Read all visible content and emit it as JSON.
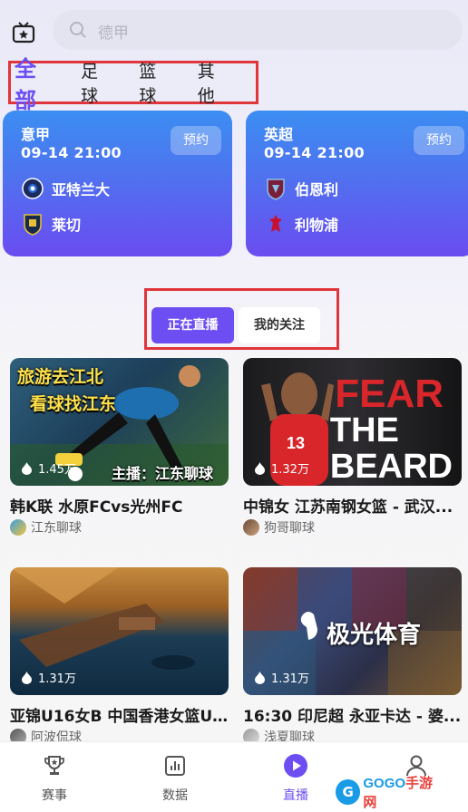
{
  "search": {
    "placeholder": "德甲"
  },
  "category_tabs": [
    "全部",
    "足球",
    "篮球",
    "其他"
  ],
  "matches": [
    {
      "league": "意甲",
      "time": "09-14 21:00",
      "button": "预约",
      "home": "亚特兰大",
      "away": "莱切"
    },
    {
      "league": "英超",
      "time": "09-14 21:00",
      "button": "预约",
      "home": "伯恩利",
      "away": "利物浦"
    }
  ],
  "live_toggle": {
    "live": "正在直播",
    "follow": "我的关注"
  },
  "streams": [
    {
      "views": "1.45万",
      "title": "韩K联 水原FCvs光州FC",
      "host": "江东聊球",
      "overlay_1": "旅游去江北",
      "overlay_2": "看球找江东",
      "overlay_3": "主播：江东聊球"
    },
    {
      "views": "1.32万",
      "title": "中锦女 江苏南钢女篮 - 武汉...",
      "host": "狗哥聊球",
      "overlay_1": "FEAR",
      "overlay_2": "THE",
      "overlay_3": "BEARD"
    },
    {
      "views": "1.31万",
      "title": "亚锦U16女B 中国香港女篮U...",
      "host": "阿波侃球"
    },
    {
      "views": "1.31万",
      "title": "16:30 印尼超 永亚卡达 - 婆...",
      "host": "浅夏聊球",
      "overlay_1": "极光体育"
    }
  ],
  "bottom_nav": [
    {
      "label": "赛事",
      "icon": "trophy-icon"
    },
    {
      "label": "数据",
      "icon": "chart-icon"
    },
    {
      "label": "直播",
      "icon": "play-icon"
    },
    {
      "label": "",
      "icon": "profile-icon"
    }
  ],
  "watermark": {
    "g": "G",
    "text": "GOGO",
    "sub": "手游网"
  },
  "colors": {
    "accent": "#6c4ef2",
    "highlight_border": "#e0353a",
    "card_top": "#3b8ef2",
    "card_bottom": "#6a4cf0"
  }
}
